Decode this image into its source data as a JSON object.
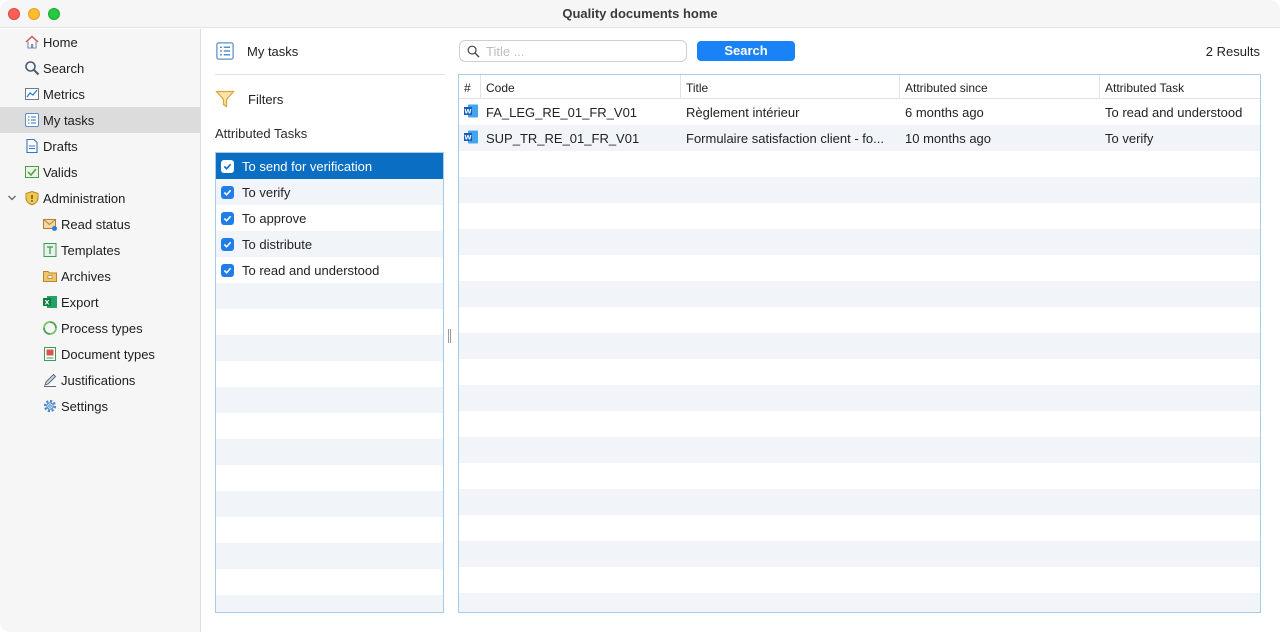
{
  "window": {
    "title": "Quality documents home"
  },
  "sidebar": {
    "items": [
      {
        "label": "Home",
        "icon": "home-icon"
      },
      {
        "label": "Search",
        "icon": "search-icon"
      },
      {
        "label": "Metrics",
        "icon": "metrics-icon"
      },
      {
        "label": "My tasks",
        "icon": "tasks-icon",
        "selected": true
      },
      {
        "label": "Drafts",
        "icon": "drafts-icon"
      },
      {
        "label": "Valids",
        "icon": "valids-icon"
      },
      {
        "label": "Administration",
        "icon": "shield-icon",
        "expanded": true
      },
      {
        "label": "Read status",
        "icon": "read-status-icon"
      },
      {
        "label": "Templates",
        "icon": "templates-icon"
      },
      {
        "label": "Archives",
        "icon": "archives-icon"
      },
      {
        "label": "Export",
        "icon": "excel-icon"
      },
      {
        "label": "Process types",
        "icon": "process-icon"
      },
      {
        "label": "Document types",
        "icon": "document-types-icon"
      },
      {
        "label": "Justifications",
        "icon": "pen-icon"
      },
      {
        "label": "Settings",
        "icon": "gear-icon"
      }
    ]
  },
  "middle": {
    "title": "My tasks",
    "filters_label": "Filters",
    "attributed_label": "Attributed Tasks",
    "tasks": [
      {
        "label": "To send for verification",
        "checked": true,
        "selected": true
      },
      {
        "label": "To verify",
        "checked": true
      },
      {
        "label": "To approve",
        "checked": true
      },
      {
        "label": "To distribute",
        "checked": true
      },
      {
        "label": "To read and understood",
        "checked": true
      }
    ]
  },
  "main": {
    "search": {
      "placeholder": "Title ...",
      "value": "",
      "button_label": "Search"
    },
    "results_label": "2 Results",
    "table": {
      "columns": [
        "#",
        "Code",
        "Title",
        "Attributed since",
        "Attributed Task"
      ],
      "rows": [
        {
          "icon": "word-doc-icon",
          "code": "FA_LEG_RE_01_FR_V01",
          "title": "Règlement intérieur",
          "since": "6 months ago",
          "task": "To read and understood"
        },
        {
          "icon": "word-doc-icon",
          "code": "SUP_TR_RE_01_FR_V01",
          "title": "Formulaire satisfaction client - fo...",
          "since": "10 months ago",
          "task": "To verify"
        }
      ]
    }
  },
  "colors": {
    "accent": "#1a82f7",
    "selection": "#0a6fc2",
    "table_border": "#a8cbe6"
  }
}
